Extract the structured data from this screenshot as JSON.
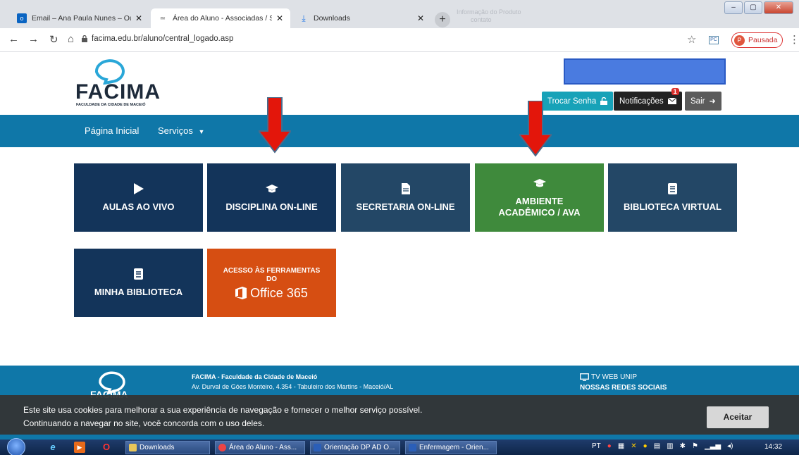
{
  "browser": {
    "tabs": [
      {
        "title": "Email – Ana Paula Nunes – Outlo",
        "active": false,
        "icon": "outlook-icon"
      },
      {
        "title": "Área do Aluno - Associadas / Su",
        "active": true,
        "icon": "site-icon"
      },
      {
        "title": "Downloads",
        "active": false,
        "icon": "download-icon"
      }
    ],
    "new_tab_label": "+",
    "url": "facima.edu.br/aluno/central_logado.asp",
    "profile_initial": "P",
    "profile_label": "Pausada",
    "ghost_text_1": "Informação do Produto",
    "ghost_text_2": "contato"
  },
  "site": {
    "logo_text": "FACIMA",
    "logo_subtitle": "FACULDADE DA CIDADE DE MACEIÓ",
    "header_buttons": {
      "trocar_senha": "Trocar Senha",
      "notificacoes": "Notificações",
      "notif_count": "1",
      "sair": "Sair"
    },
    "nav": {
      "home": "Página Inicial",
      "services": "Serviços"
    },
    "tiles": [
      {
        "label": "AULAS AO VIVO",
        "icon": "play-icon",
        "color": "#13345a"
      },
      {
        "label": "DISCIPLINA ON-LINE",
        "icon": "graduation-cap-icon",
        "color": "#13345a"
      },
      {
        "label": "SECRETARIA ON-LINE",
        "icon": "document-icon",
        "color": "#234766"
      },
      {
        "label": "AMBIENTE ACADÊMICO / AVA",
        "icon": "graduation-cap-icon",
        "color": "#3f8a3c"
      },
      {
        "label": "BIBLIOTECA VIRTUAL",
        "icon": "book-icon",
        "color": "#234766"
      },
      {
        "label": "MINHA BIBLIOTECA",
        "icon": "book-icon",
        "color": "#13345a"
      }
    ],
    "office_tile": {
      "line1": "ACESSO ÀS FERRAMENTAS",
      "line2": "DO",
      "brand": "Office 365",
      "color": "#d64e12"
    },
    "footer": {
      "name": "FACIMA - Faculdade da Cidade de Maceió",
      "address": "Av. Durval de Góes Monteiro, 4.354 - Tabuleiro dos Martins - Maceió/AL",
      "tv": "TV WEB UNIP",
      "social": "NOSSAS REDES SOCIAIS"
    },
    "cookie": {
      "line1": "Este site usa cookies para melhorar a sua experiência de navegação e fornecer o melhor serviço possível.",
      "line2": "Continuando a navegar no site, você concorda com o uso deles.",
      "accept": "Aceitar"
    }
  },
  "taskbar": {
    "tasks": [
      {
        "label": "Downloads",
        "icon": "folder-icon"
      },
      {
        "label": "Área do Aluno - Ass...",
        "icon": "chrome-icon"
      },
      {
        "label": "Orientação DP AD O...",
        "icon": "word-icon"
      },
      {
        "label": "Enfermagem - Orien...",
        "icon": "word-icon"
      }
    ],
    "lang": "PT",
    "time": "14:32"
  },
  "colors": {
    "navbar": "#0f77a8",
    "arrow": "#e3160b",
    "accent_green": "#3f8a3c"
  }
}
